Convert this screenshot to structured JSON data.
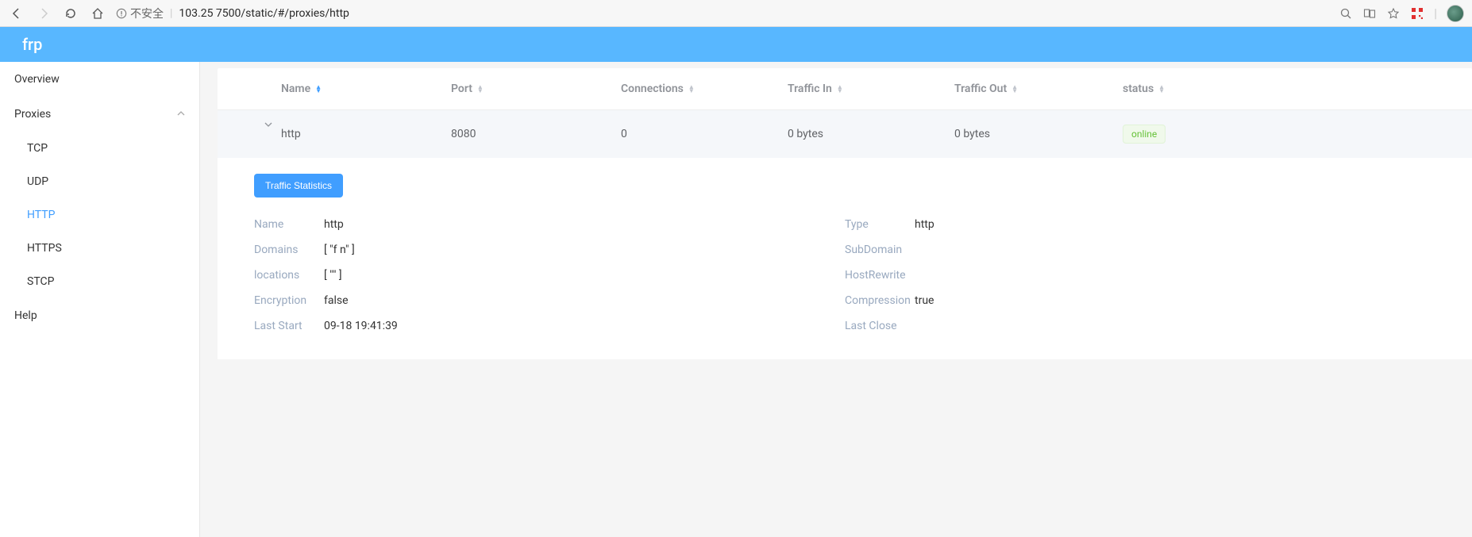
{
  "browser": {
    "insecure_label": "不安全",
    "url": "103.25          7500/static/#/proxies/http"
  },
  "header": {
    "brand": "frp"
  },
  "sidebar": {
    "overview": "Overview",
    "proxies": "Proxies",
    "items": {
      "tcp": "TCP",
      "udp": "UDP",
      "http": "HTTP",
      "https": "HTTPS",
      "stcp": "STCP"
    },
    "help": "Help"
  },
  "table": {
    "columns": {
      "name": "Name",
      "port": "Port",
      "connections": "Connections",
      "traffic_in": "Traffic In",
      "traffic_out": "Traffic Out",
      "status": "status"
    },
    "row": {
      "name": "http",
      "port": "8080",
      "connections": "0",
      "traffic_in": "0 bytes",
      "traffic_out": "0 bytes",
      "status": "online"
    }
  },
  "details": {
    "traffic_button": "Traffic Statistics",
    "left": {
      "name_label": "Name",
      "name_value": "http",
      "domains_label": "Domains",
      "domains_value": "[ \"f            n\" ]",
      "locations_label": "locations",
      "locations_value": "[ \"\" ]",
      "encryption_label": "Encryption",
      "encryption_value": "false",
      "last_start_label": "Last Start",
      "last_start_value": "09-18 19:41:39"
    },
    "right": {
      "type_label": "Type",
      "type_value": "http",
      "subdomain_label": "SubDomain",
      "subdomain_value": "",
      "hostrewrite_label": "HostRewrite",
      "hostrewrite_value": "",
      "compression_label": "Compression",
      "compression_value": "true",
      "last_close_label": "Last Close",
      "last_close_value": ""
    }
  }
}
